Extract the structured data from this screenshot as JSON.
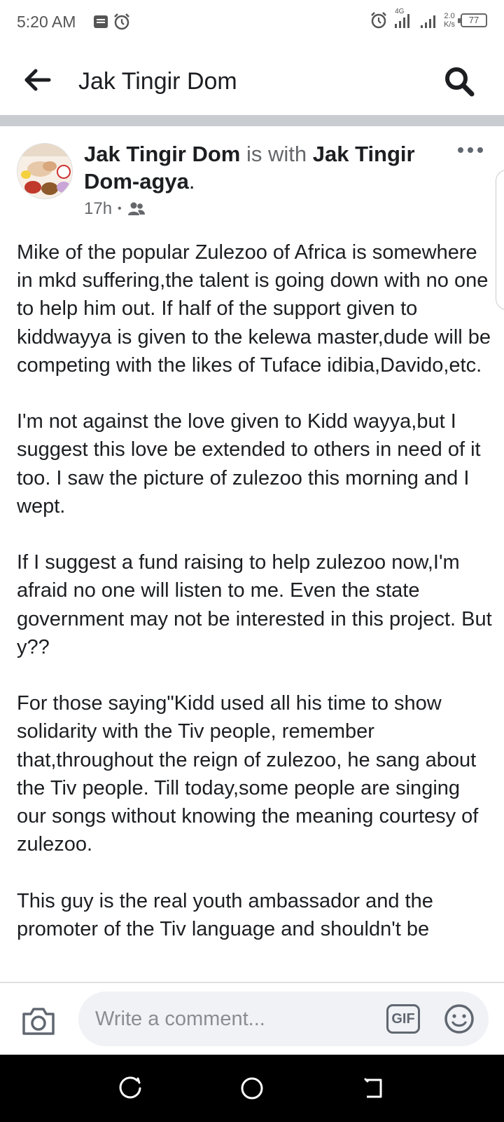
{
  "status_bar": {
    "time": "5:20 AM",
    "network_type": "4G",
    "speed_value": "2.0",
    "speed_unit": "K/s",
    "battery": "77",
    "icons": [
      "notification-icon",
      "alarm-icon",
      "alarm-icon",
      "signal-icon",
      "signal-icon",
      "battery-icon"
    ]
  },
  "header": {
    "title": "Jak Tingir Dom",
    "back_icon": "back-arrow-icon",
    "search_icon": "search-icon"
  },
  "post": {
    "author": "Jak Tingir Dom",
    "with_text": " is with ",
    "tagged": "Jak Tingir Dom-agya",
    "period": ".",
    "time": "17h",
    "separator": "•",
    "audience_icon": "friends-icon",
    "more_icon": "more-options-icon",
    "paragraphs": [
      "Mike of the popular Zulezoo of Africa is somewhere in mkd suffering,the talent is going down with no one to help him out. If half of the support given to kiddwayya is  given to the kelewa master,dude will be competing with the likes of Tuface idibia,Davido,etc.",
      "I'm not against the love given to Kidd wayya,but I suggest this love be extended to others in need of it too.  I saw the picture of zulezoo this morning and I wept.",
      "If I suggest a fund raising to help zulezoo now,I'm afraid no one will listen to me. Even the state government may not be interested in this project. But y??",
      "For those saying\"Kidd used all his time to show solidarity with the Tiv people, remember that,throughout the reign of zulezoo, he sang about the Tiv people. Till today,some people are singing our songs without knowing the meaning courtesy of zulezoo.",
      "This guy is the real youth ambassador and the promoter of the Tiv language and shouldn't be"
    ]
  },
  "comment_bar": {
    "placeholder": "Write a comment...",
    "gif_label": "GIF",
    "camera_icon": "camera-icon",
    "emoji_icon": "emoji-icon"
  },
  "nav_bar": {
    "icons": [
      "recents-icon",
      "home-icon",
      "back-icon"
    ]
  }
}
